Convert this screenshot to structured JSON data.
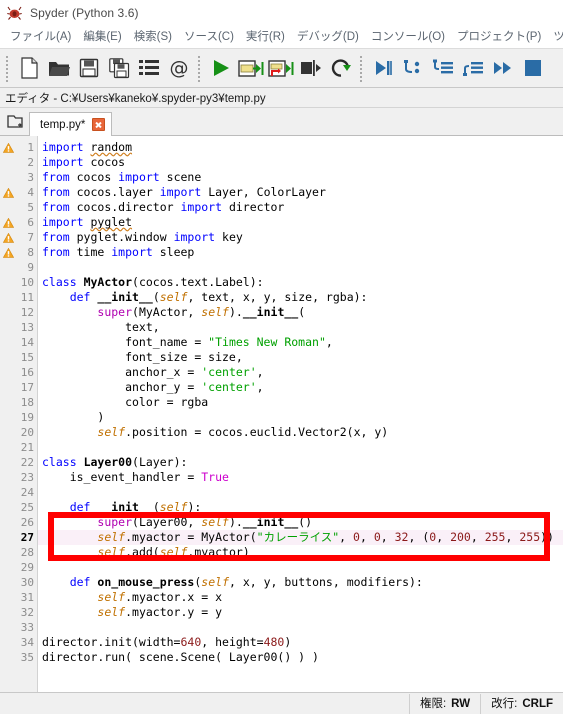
{
  "window": {
    "title": "Spyder (Python 3.6)",
    "app_icon": "spyder-logo-icon"
  },
  "menubar": {
    "items": [
      {
        "label": "ファイル(A)",
        "name": "menu-file"
      },
      {
        "label": "編集(E)",
        "name": "menu-edit"
      },
      {
        "label": "検索(S)",
        "name": "menu-search"
      },
      {
        "label": "ソース(C)",
        "name": "menu-source"
      },
      {
        "label": "実行(R)",
        "name": "menu-run"
      },
      {
        "label": "デバッグ(D)",
        "name": "menu-debug"
      },
      {
        "label": "コンソール(O)",
        "name": "menu-console"
      },
      {
        "label": "プロジェクト(P)",
        "name": "menu-projects"
      },
      {
        "label": "ツール(T)",
        "name": "menu-tools"
      }
    ]
  },
  "toolbar": {
    "buttons": [
      {
        "icon": "new-file-icon",
        "tip": "新規ファイル"
      },
      {
        "icon": "open-file-icon",
        "tip": "ファイルを開く"
      },
      {
        "icon": "save-file-icon",
        "tip": "保存"
      },
      {
        "icon": "save-all-icon",
        "tip": "すべて保存"
      },
      {
        "icon": "file-list-icon",
        "tip": "ファイル一覧"
      },
      {
        "icon": "at-sign-icon",
        "tip": "メール"
      },
      {
        "icon": "run-file-icon",
        "tip": "ファイルを実行"
      },
      {
        "icon": "run-cell-icon",
        "tip": "セルを実行"
      },
      {
        "icon": "run-cell-advance-icon",
        "tip": "セルを実行して進む"
      },
      {
        "icon": "run-selection-icon",
        "tip": "選択範囲を実行"
      },
      {
        "icon": "rerun-icon",
        "tip": "再実行"
      },
      {
        "icon": "debug-file-icon",
        "tip": "デバッグ"
      },
      {
        "icon": "debug-step-icon",
        "tip": "ステップ"
      },
      {
        "icon": "debug-step-into-icon",
        "tip": "ステップイン"
      },
      {
        "icon": "debug-step-return-icon",
        "tip": "ステップアウト"
      },
      {
        "icon": "debug-continue-icon",
        "tip": "続行"
      },
      {
        "icon": "debug-stop-icon",
        "tip": "停止"
      }
    ]
  },
  "editor": {
    "pane_title": "エディタ - C:¥Users¥kaneko¥.spyder-py3¥temp.py",
    "browse_icon": "browse-tabs-icon",
    "tab": {
      "label": "temp.py*",
      "close_icon": "close-tab-icon"
    },
    "current_line": 27,
    "warning_lines": [
      1,
      4,
      6,
      7,
      8
    ],
    "lines": [
      {
        "n": 1,
        "tokens": [
          {
            "t": "import",
            "c": "kw"
          },
          {
            "t": " "
          },
          {
            "t": "random",
            "c": "sq"
          }
        ]
      },
      {
        "n": 2,
        "tokens": [
          {
            "t": "import",
            "c": "kw"
          },
          {
            "t": " cocos"
          }
        ]
      },
      {
        "n": 3,
        "tokens": [
          {
            "t": "from",
            "c": "kw"
          },
          {
            "t": " cocos "
          },
          {
            "t": "import",
            "c": "kw"
          },
          {
            "t": " scene"
          }
        ]
      },
      {
        "n": 4,
        "tokens": [
          {
            "t": "from",
            "c": "kw"
          },
          {
            "t": " cocos.layer "
          },
          {
            "t": "import",
            "c": "kw"
          },
          {
            "t": " Layer, ColorLayer"
          }
        ]
      },
      {
        "n": 5,
        "tokens": [
          {
            "t": "from",
            "c": "kw"
          },
          {
            "t": " cocos.director "
          },
          {
            "t": "import",
            "c": "kw"
          },
          {
            "t": " director"
          }
        ]
      },
      {
        "n": 6,
        "tokens": [
          {
            "t": "import",
            "c": "kw"
          },
          {
            "t": " "
          },
          {
            "t": "pyglet",
            "c": "sq"
          }
        ]
      },
      {
        "n": 7,
        "tokens": [
          {
            "t": "from",
            "c": "kw"
          },
          {
            "t": " pyglet.window "
          },
          {
            "t": "import",
            "c": "kw"
          },
          {
            "t": " key"
          }
        ]
      },
      {
        "n": 8,
        "tokens": [
          {
            "t": "from",
            "c": "kw"
          },
          {
            "t": " time "
          },
          {
            "t": "import",
            "c": "kw"
          },
          {
            "t": " sleep"
          }
        ]
      },
      {
        "n": 9,
        "tokens": []
      },
      {
        "n": 10,
        "tokens": [
          {
            "t": "class",
            "c": "kw"
          },
          {
            "t": " "
          },
          {
            "t": "MyActor",
            "c": "cls"
          },
          {
            "t": "(cocos.text.Label):"
          }
        ]
      },
      {
        "n": 11,
        "tokens": [
          {
            "t": "    "
          },
          {
            "t": "def",
            "c": "kw"
          },
          {
            "t": " "
          },
          {
            "t": "__init__",
            "c": "fn"
          },
          {
            "t": "("
          },
          {
            "t": "self",
            "c": "self"
          },
          {
            "t": ", text, x, y, size, rgba):"
          }
        ]
      },
      {
        "n": 12,
        "tokens": [
          {
            "t": "        "
          },
          {
            "t": "super",
            "c": "kw2"
          },
          {
            "t": "(MyActor, "
          },
          {
            "t": "self",
            "c": "self"
          },
          {
            "t": ")."
          },
          {
            "t": "__init__",
            "c": "fn"
          },
          {
            "t": "("
          }
        ]
      },
      {
        "n": 13,
        "tokens": [
          {
            "t": "            text,"
          }
        ]
      },
      {
        "n": 14,
        "tokens": [
          {
            "t": "            font_name = "
          },
          {
            "t": "\"Times New Roman\"",
            "c": "str"
          },
          {
            "t": ","
          }
        ]
      },
      {
        "n": 15,
        "tokens": [
          {
            "t": "            font_size = size,"
          }
        ]
      },
      {
        "n": 16,
        "tokens": [
          {
            "t": "            anchor_x = "
          },
          {
            "t": "'center'",
            "c": "str"
          },
          {
            "t": ","
          }
        ]
      },
      {
        "n": 17,
        "tokens": [
          {
            "t": "            anchor_y = "
          },
          {
            "t": "'center'",
            "c": "str"
          },
          {
            "t": ","
          }
        ]
      },
      {
        "n": 18,
        "tokens": [
          {
            "t": "            color = rgba"
          }
        ]
      },
      {
        "n": 19,
        "tokens": [
          {
            "t": "        )"
          }
        ]
      },
      {
        "n": 20,
        "tokens": [
          {
            "t": "        "
          },
          {
            "t": "self",
            "c": "self"
          },
          {
            "t": ".position = cocos.euclid.Vector2(x, y)"
          }
        ]
      },
      {
        "n": 21,
        "tokens": []
      },
      {
        "n": 22,
        "tokens": [
          {
            "t": "class",
            "c": "kw"
          },
          {
            "t": " "
          },
          {
            "t": "Layer00",
            "c": "cls"
          },
          {
            "t": "(Layer):"
          }
        ]
      },
      {
        "n": 23,
        "tokens": [
          {
            "t": "    is_event_handler = "
          },
          {
            "t": "True",
            "c": "tru"
          }
        ]
      },
      {
        "n": 24,
        "tokens": []
      },
      {
        "n": 25,
        "tokens": [
          {
            "t": "    "
          },
          {
            "t": "def",
            "c": "kw"
          },
          {
            "t": " "
          },
          {
            "t": "__init__",
            "c": "fn"
          },
          {
            "t": "("
          },
          {
            "t": "self",
            "c": "self"
          },
          {
            "t": "):"
          }
        ]
      },
      {
        "n": 26,
        "tokens": [
          {
            "t": "        "
          },
          {
            "t": "super",
            "c": "kw2"
          },
          {
            "t": "(Layer00, "
          },
          {
            "t": "self",
            "c": "self"
          },
          {
            "t": ")."
          },
          {
            "t": "__init__",
            "c": "fn"
          },
          {
            "t": "()"
          }
        ]
      },
      {
        "n": 27,
        "tokens": [
          {
            "t": "        "
          },
          {
            "t": "self",
            "c": "self"
          },
          {
            "t": ".myactor = MyActor("
          },
          {
            "t": "\"カレーライス\"",
            "c": "str"
          },
          {
            "t": ", "
          },
          {
            "t": "0",
            "c": "num"
          },
          {
            "t": ", "
          },
          {
            "t": "0",
            "c": "num"
          },
          {
            "t": ", "
          },
          {
            "t": "32",
            "c": "num"
          },
          {
            "t": ", ("
          },
          {
            "t": "0",
            "c": "num"
          },
          {
            "t": ", "
          },
          {
            "t": "200",
            "c": "num"
          },
          {
            "t": ", "
          },
          {
            "t": "255",
            "c": "num"
          },
          {
            "t": ", "
          },
          {
            "t": "255",
            "c": "num"
          },
          {
            "t": "))"
          }
        ]
      },
      {
        "n": 28,
        "tokens": [
          {
            "t": "        "
          },
          {
            "t": "self",
            "c": "self"
          },
          {
            "t": ".add("
          },
          {
            "t": "self",
            "c": "self"
          },
          {
            "t": ".myactor)"
          }
        ]
      },
      {
        "n": 29,
        "tokens": []
      },
      {
        "n": 30,
        "tokens": [
          {
            "t": "    "
          },
          {
            "t": "def",
            "c": "kw"
          },
          {
            "t": " "
          },
          {
            "t": "on_mouse_press",
            "c": "fn"
          },
          {
            "t": "("
          },
          {
            "t": "self",
            "c": "self"
          },
          {
            "t": ", x, y, buttons, modifiers):"
          }
        ]
      },
      {
        "n": 31,
        "tokens": [
          {
            "t": "        "
          },
          {
            "t": "self",
            "c": "self"
          },
          {
            "t": ".myactor.x = x"
          }
        ]
      },
      {
        "n": 32,
        "tokens": [
          {
            "t": "        "
          },
          {
            "t": "self",
            "c": "self"
          },
          {
            "t": ".myactor.y = y"
          }
        ]
      },
      {
        "n": 33,
        "tokens": []
      },
      {
        "n": 34,
        "tokens": [
          {
            "t": "director.init(width="
          },
          {
            "t": "640",
            "c": "num"
          },
          {
            "t": ", height="
          },
          {
            "t": "480",
            "c": "num"
          },
          {
            "t": ")"
          }
        ]
      },
      {
        "n": 35,
        "tokens": [
          {
            "t": "director.run( scene.Scene( Layer00() ) )"
          }
        ]
      }
    ]
  },
  "annotation": {
    "color": "#ff0000",
    "shape": "rectangle",
    "covers_lines": "26-28"
  },
  "statusbar": {
    "permission_label": "権限:",
    "permission_value": "RW",
    "eol_label": "改行:",
    "eol_value": "CRLF"
  }
}
